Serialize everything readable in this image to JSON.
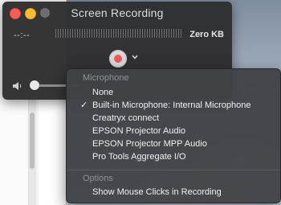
{
  "window": {
    "title": "Screen Recording",
    "time": "--:--",
    "size": "Zero KB"
  },
  "icons": {
    "record": "record-icon",
    "chevron": "chevron-down-icon",
    "volume": "speaker-icon",
    "check": "checkmark-icon"
  },
  "colors": {
    "record_dot": "#f2585c",
    "close": "#fd5f57",
    "minimize": "#febc2e"
  },
  "menu": {
    "microphone_header": "Microphone",
    "microphone_items": [
      {
        "label": "None",
        "checked": false
      },
      {
        "label": "Built-in Microphone: Internal Microphone",
        "checked": true
      },
      {
        "label": "Creatryx connect",
        "checked": false
      },
      {
        "label": "EPSON Projector Audio",
        "checked": false
      },
      {
        "label": "EPSON Projector MPP Audio",
        "checked": false
      },
      {
        "label": "Pro Tools Aggregate I/O",
        "checked": false
      }
    ],
    "options_header": "Options",
    "option_items": [
      {
        "label": "Show Mouse Clicks in Recording",
        "checked": false
      }
    ],
    "check_glyph": "✓"
  }
}
